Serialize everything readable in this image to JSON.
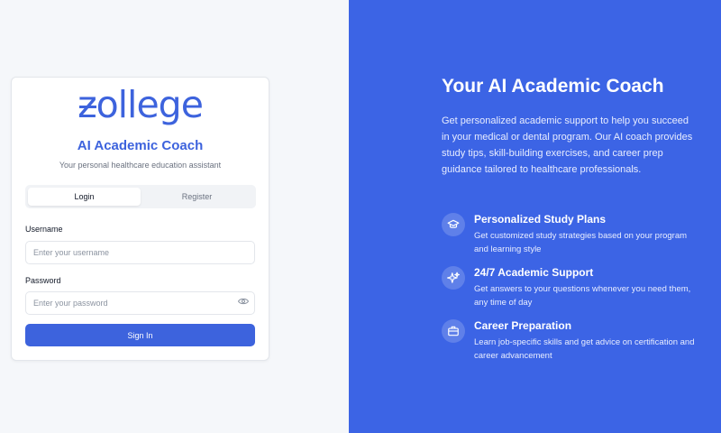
{
  "brand": {
    "logo_text": "zollege",
    "title": "AI Academic Coach",
    "subtitle": "Your personal healthcare education assistant",
    "accent_color": "#3d63dd"
  },
  "auth": {
    "tabs": [
      {
        "label": "Login",
        "active": true
      },
      {
        "label": "Register",
        "active": false
      }
    ],
    "username": {
      "label": "Username",
      "placeholder": "Enter your username",
      "value": ""
    },
    "password": {
      "label": "Password",
      "placeholder": "Enter your password",
      "value": ""
    },
    "submit_label": "Sign In"
  },
  "hero": {
    "title": "Your AI Academic Coach",
    "description": "Get personalized academic support to help you succeed in your medical or dental program. Our AI coach provides study tips, skill-building exercises, and career prep guidance tailored to healthcare professionals.",
    "background_color": "#3c64e5",
    "features": [
      {
        "icon": "graduation-cap-icon",
        "title": "Personalized Study Plans",
        "description": "Get customized study strategies based on your program and learning style"
      },
      {
        "icon": "sparkles-icon",
        "title": "24/7 Academic Support",
        "description": "Get answers to your questions whenever you need them, any time of day"
      },
      {
        "icon": "briefcase-icon",
        "title": "Career Preparation",
        "description": "Learn job-specific skills and get advice on certification and career advancement"
      }
    ]
  }
}
